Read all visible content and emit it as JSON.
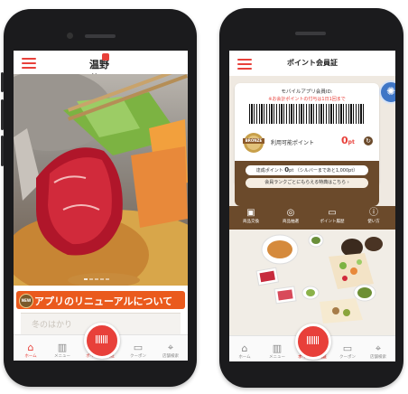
{
  "left_screen": {
    "logo_text": "温野菜",
    "banner_title": "アプリのリニューアルについて",
    "banner_badge": "NEW",
    "info_text": "冬のはかり",
    "nav": [
      {
        "label": "ホーム",
        "icon": "home-icon"
      },
      {
        "label": "メニュー",
        "icon": "book-icon"
      },
      {
        "label": "ポイント会員証",
        "icon": "barcode-icon"
      },
      {
        "label": "クーポン",
        "icon": "ticket-icon"
      },
      {
        "label": "店舗検索",
        "icon": "location-pin-icon"
      }
    ]
  },
  "right_screen": {
    "header_title": "ポイント会員証",
    "card_title": "モバイルアプリ会員ID:",
    "card_note": "※お会計ポイントの付与は1日1回まで",
    "rank_badge": "BRONZE",
    "points_label": "利用可能ポイント",
    "points_value": "0",
    "points_unit": "pt",
    "progress_text_prefix": "達成ポイント",
    "progress_value": "0",
    "progress_unit": "pt",
    "progress_note": "（シルバーまであと1,000pt）",
    "rank_benefit_link": "会員ランクごとにもらえる特典はこちら",
    "quick_actions": [
      {
        "label": "商品交換",
        "icon": "gift-icon"
      },
      {
        "label": "商品抽選",
        "icon": "target-icon"
      },
      {
        "label": "ポイント履歴",
        "icon": "card-icon"
      },
      {
        "label": "使い方",
        "icon": "info-icon"
      }
    ],
    "nav": [
      {
        "label": "ホーム",
        "icon": "home-icon"
      },
      {
        "label": "メニュー",
        "icon": "book-icon"
      },
      {
        "label": "ポイント会員証",
        "icon": "barcode-icon"
      },
      {
        "label": "クーポン",
        "icon": "ticket-icon"
      },
      {
        "label": "店舗検索",
        "icon": "location-pin-icon"
      }
    ]
  },
  "colors": {
    "accent": "#e8403a",
    "brown": "#6b4a2b",
    "gold": "#c8a04a"
  }
}
